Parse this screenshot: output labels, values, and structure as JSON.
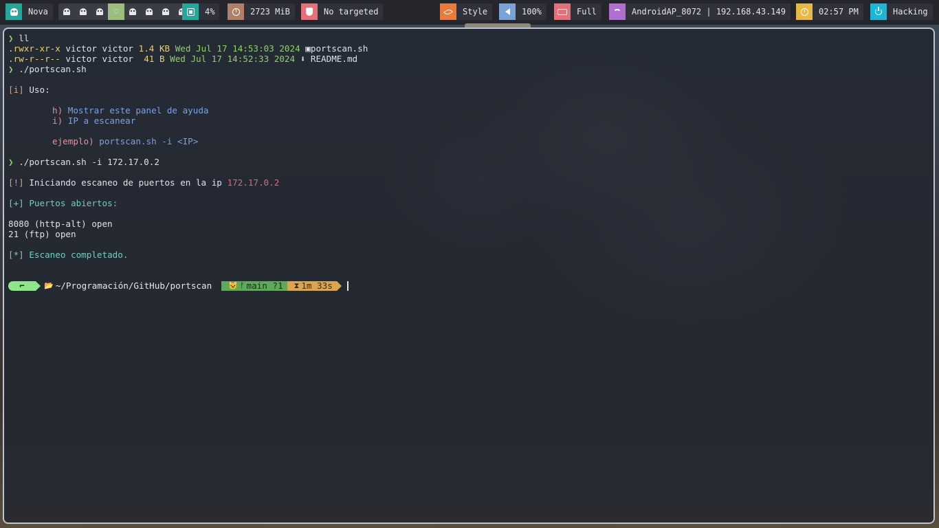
{
  "topbar": {
    "left": {
      "os_label": "Nova",
      "cpu": "4%",
      "memory": "2723 MiB",
      "target": "No targeted"
    },
    "right": {
      "style": "Style",
      "volume": "100%",
      "battery": "Full",
      "network": "AndroidAP_8072 | 192.168.43.149",
      "time": "02:57 PM",
      "mode": "Hacking"
    },
    "workspace_active_index": 3,
    "colors": {
      "os": "#23a89b",
      "cpu": "#23a89b",
      "memory": "#b07f6a",
      "target": "#e5707a",
      "style": "#ea7a3a",
      "volume": "#7aa2d6",
      "battery": "#e5707a",
      "network": "#b06fcf",
      "time": "#e9b842",
      "mode": "#1fb6d6"
    }
  },
  "terminal": {
    "cmd1": "ll",
    "files": [
      {
        "perms": ".rwxr-xr-x",
        "user": "victor",
        "group": "victor",
        "size": "1.4 KB",
        "date": "Wed Jul 17 14:53:03 2024",
        "icon": "",
        "name": "portscan.sh"
      },
      {
        "perms": ".rw-r--r--",
        "user": "victor",
        "group": "victor",
        "size": " 41 B",
        "date": "Wed Jul 17 14:52:33 2024",
        "icon": "",
        "name": "README.md"
      }
    ],
    "cmd2": "./portscan.sh",
    "help": {
      "uso_tag": "[i]",
      "uso_label": "Uso:",
      "h_key": "h)",
      "h_text": "Mostrar este panel de ayuda",
      "i_key": "i)",
      "i_text": "IP a escanear",
      "ex_key": "ejemplo)",
      "ex_cmd": "portscan.sh -i <IP>"
    },
    "cmd3": "./portscan.sh -i 172.17.0.2",
    "start_tag": "[!]",
    "start_text": "Iniciando escaneo de puertos en la ip",
    "start_ip": "172.17.0.2",
    "open_tag": "[+]",
    "open_text": "Puertos abiertos:",
    "ports": [
      "8080 (http-alt) open",
      "21 (ftp) open"
    ],
    "done_tag": "[*]",
    "done_text": "Escaneo completado.",
    "prompt": {
      "path": "~/Programación/GitHub/portscan",
      "branch": "main ?1",
      "duration": "1m 33s"
    }
  }
}
